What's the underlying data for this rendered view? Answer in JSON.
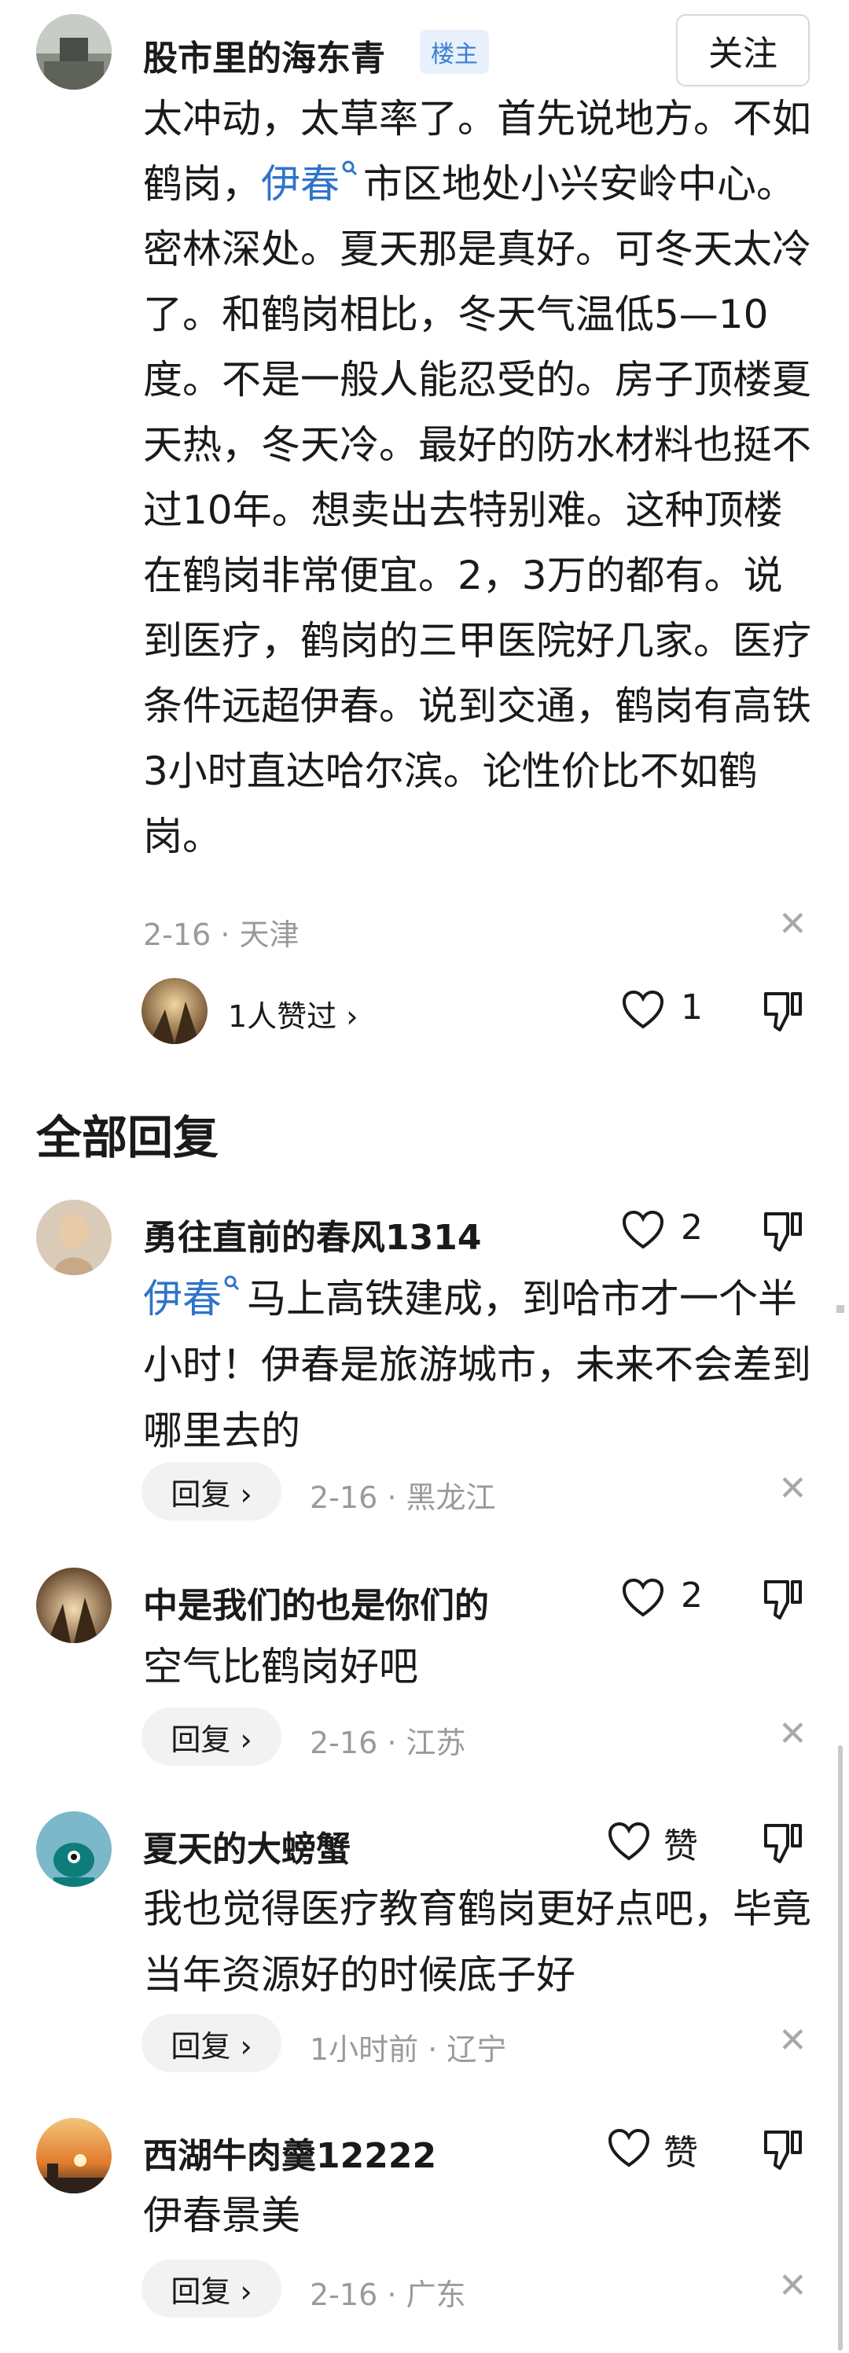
{
  "main_post": {
    "author": "股市里的海东青",
    "badge": "楼主",
    "follow_label": "关注",
    "text_before_link": "太冲动，太草率了。首先说地方。不如鹤岗，",
    "link_text": "伊春",
    "text_after_link": "市区地处小兴安岭中心。密林深处。夏天那是真好。可冬天太冷了。和鹤岗相比，冬天气温低5—10度。不是一般人能忍受的。房子顶楼夏天热，冬天冷。最好的防水材料也挺不过10年。想卖出去特别难。这种顶楼在鹤岗非常便宜。2，3万的都有。说到医疗，鹤岗的三甲医院好几家。医疗条件远超伊春。说到交通，鹤岗有高铁3小时直达哈尔滨。论性价比不如鹤岗。",
    "meta": "2-16 · 天津",
    "liked_by": "1人赞过 ›",
    "like_count": "1"
  },
  "section_title": "全部回复",
  "reply_label": "回复 ›",
  "replies": [
    {
      "author": "勇往直前的春风1314",
      "like_count": "2",
      "link_text": "伊春",
      "text": "马上高铁建成，到哈市才一个半小时！伊春是旅游城市，未来不会差到哪里去的",
      "meta": "2-16 · 黑龙江"
    },
    {
      "author": "中是我们的也是你们的",
      "like_count": "2",
      "text": "空气比鹤岗好吧",
      "meta": "2-16 · 江苏"
    },
    {
      "author": "夏天的大螃蟹",
      "like_count": "赞",
      "text": "我也觉得医疗教育鹤岗更好点吧，毕竟当年资源好的时候底子好",
      "meta": "1小时前 · 辽宁"
    },
    {
      "author": "西湖牛肉羹12222",
      "like_count": "赞",
      "text": "伊春景美",
      "meta": "2-16 · 广东"
    }
  ],
  "colors": {
    "link": "#2f74c8",
    "meta": "#9a9a9a",
    "badge_bg": "#e8f1fb"
  }
}
